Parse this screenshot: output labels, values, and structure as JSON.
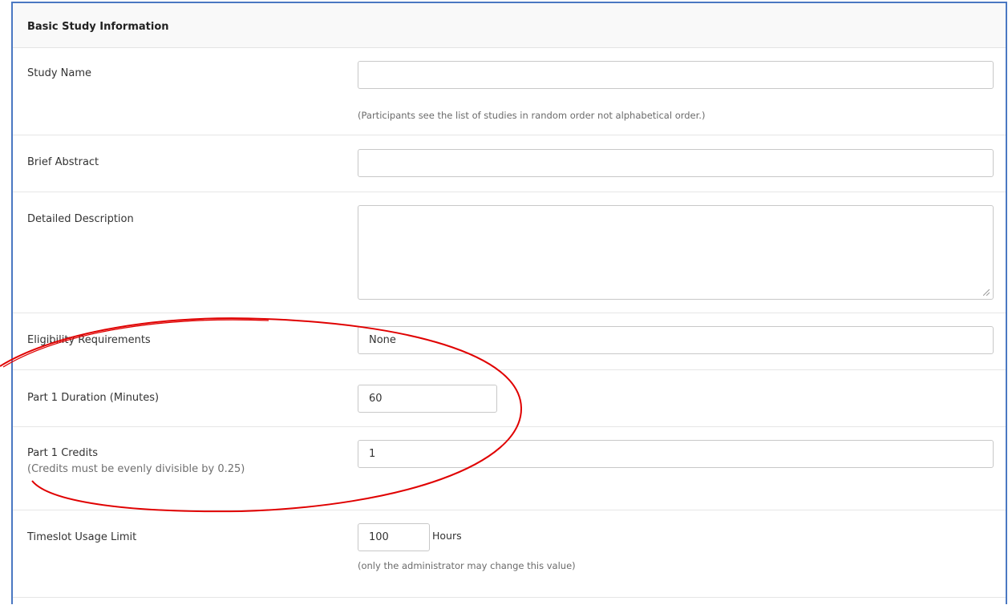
{
  "section": {
    "title": "Basic Study Information"
  },
  "study_name": {
    "label": "Study Name",
    "value": "",
    "help": "(Participants see the list of studies in random order not alphabetical order.)"
  },
  "brief_abstract": {
    "label": "Brief Abstract",
    "value": ""
  },
  "detailed_description": {
    "label": "Detailed Description",
    "value": ""
  },
  "eligibility": {
    "label": "Eligibility Requirements",
    "value": "None"
  },
  "duration": {
    "label": "Part 1 Duration (Minutes)",
    "value": "60"
  },
  "credits": {
    "label": "Part 1 Credits",
    "note": "(Credits must be evenly divisible by 0.25)",
    "value": "1"
  },
  "timeslot": {
    "label": "Timeslot Usage Limit",
    "value": "100",
    "unit": "Hours",
    "help": "(only the administrator may change this value)"
  },
  "colors": {
    "frame": "#4a78c2",
    "annotation": "#e00000"
  }
}
